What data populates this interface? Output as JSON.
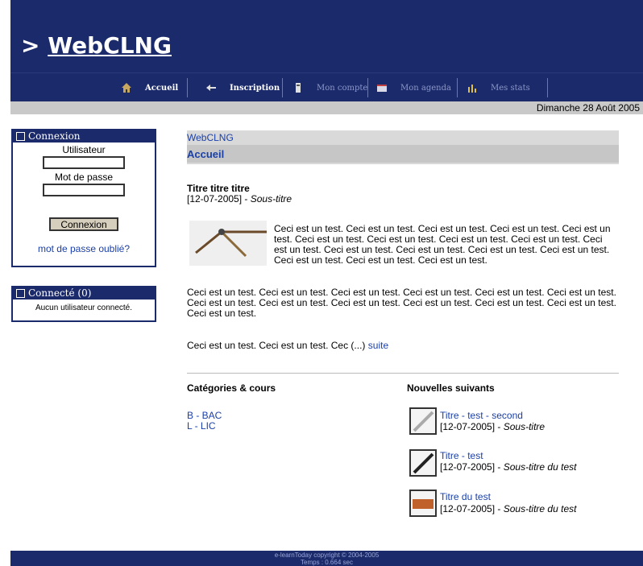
{
  "header": {
    "prefix": ">",
    "site_name": "WebCLNG"
  },
  "nav": {
    "items": [
      {
        "label": "Accueil",
        "icon": "home-icon"
      },
      {
        "label": "Inscription",
        "icon": "register-icon"
      },
      {
        "label": "Mon compte",
        "icon": "account-icon"
      },
      {
        "label": "Mon agenda",
        "icon": "calendar-icon"
      },
      {
        "label": "Mes stats",
        "icon": "stats-icon"
      }
    ]
  },
  "date": "Dimanche 28 Août 2005",
  "login": {
    "title": "Connexion",
    "user_label": "Utilisateur",
    "password_label": "Mot de passe",
    "submit": "Connexion",
    "forgot": "mot de passe oublié?"
  },
  "connected": {
    "title": "Connecté (0)",
    "empty": "Aucun utilisateur connecté."
  },
  "breadcrumb": {
    "site": "WebCLNG",
    "page": "Accueil"
  },
  "article": {
    "title": "Titre titre titre",
    "date": "[12-07-2005]",
    "sep": "-",
    "subtitle": "Sous-titre",
    "para1": "Ceci est un test. Ceci est un test. Ceci est un test. Ceci est un test. Ceci est un test. Ceci est un test. Ceci est un test. Ceci est un test. Ceci est un test. Ceci est un test. Ceci est un test. Ceci est un test. Ceci est un test. Ceci est un test. Ceci est un test. Ceci est un test. Ceci est un test.",
    "para2": "Ceci est un test. Ceci est un test. Ceci est un test. Ceci est un test. Ceci est un test. Ceci est un test. Ceci est un test. Ceci est un test. Ceci est un test. Ceci est un test. Ceci est un test. Ceci est un test. Ceci est un test.",
    "para3": "Ceci est un test. Ceci est un test. Cec (...)",
    "more": "suite"
  },
  "categories": {
    "title": "Catégories & cours",
    "items": [
      "B - BAC",
      "L - LIC"
    ]
  },
  "news": {
    "title": "Nouvelles suivants",
    "items": [
      {
        "title": "Titre - test - second",
        "date": "[12-07-2005]",
        "sep": "-",
        "subtitle": "Sous-titre"
      },
      {
        "title": "Titre - test",
        "date": "[12-07-2005]",
        "sep": "-",
        "subtitle": "Sous-titre du test"
      },
      {
        "title": "Titre du test",
        "date": "[12-07-2005]",
        "sep": "-",
        "subtitle": "Sous-titre du test"
      }
    ]
  },
  "footer": {
    "copyright": "e-learnToday copyright © 2004-2005",
    "timing": "Temps : 0.664 sec"
  },
  "colors": {
    "header": "#1b2a6b",
    "link": "#1a3fa8",
    "date_bar": "#c9c9c9"
  }
}
